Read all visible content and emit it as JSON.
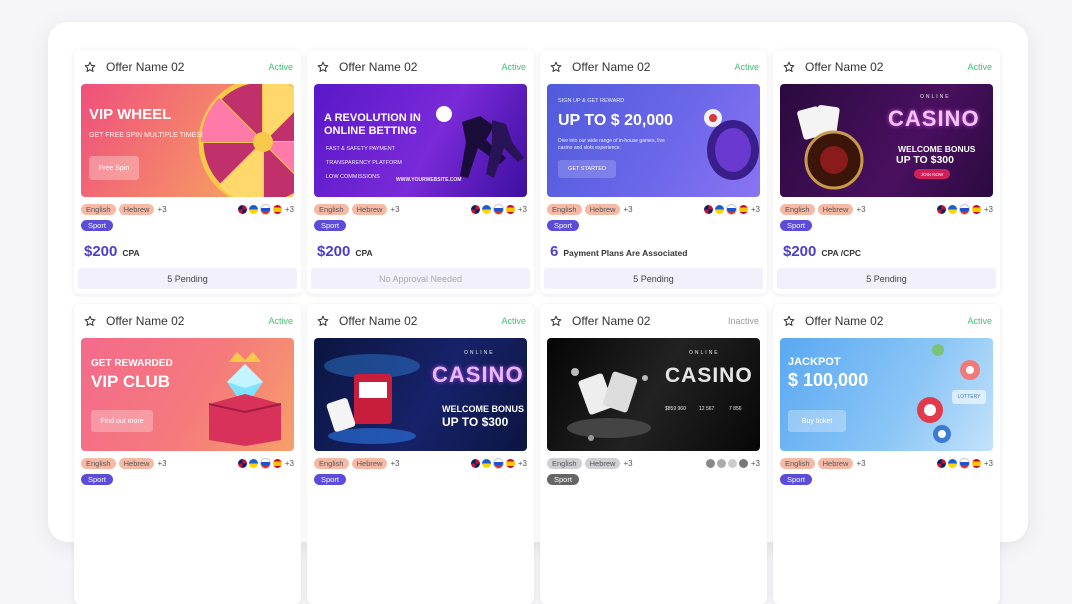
{
  "offers": [
    {
      "name": "Offer Name 02",
      "status": "Active",
      "tags": [
        "English",
        "Hebrew"
      ],
      "tags_more": "+3",
      "flags_more": "+3",
      "category": "Sport",
      "amount": "$200",
      "unit": "CPA",
      "footer": "5 Pending",
      "banner": {
        "title": "VIP WHEEL",
        "sub": "GET FREE SPIN MULTIPLE TIMES!",
        "button": "Free Spin"
      }
    },
    {
      "name": "Offer Name 02",
      "status": "Active",
      "tags": [
        "English",
        "Hebrew"
      ],
      "tags_more": "+3",
      "flags_more": "+3",
      "category": "Sport",
      "amount": "$200",
      "unit": "CPA",
      "footer": "No Approval Needed",
      "banner": {
        "title": "A REVOLUTION IN ONLINE BETTING",
        "bullets": [
          "FAST & SAFETY PAYMENT",
          "TRANSPARENCY PLATFORM",
          "LOW COMMISSIONS"
        ],
        "site": "WWW.YOURWEBSITE.COM"
      }
    },
    {
      "name": "Offer Name 02",
      "status": "Active",
      "tags": [
        "English",
        "Hebrew"
      ],
      "tags_more": "+3",
      "flags_more": "+3",
      "category": "Sport",
      "amount": "6",
      "unit": "Payment Plans Are Associated",
      "footer": "5 Pending",
      "banner": {
        "kicker": "SIGN UP & GET REWARD",
        "title": "UP TO $ 20,000",
        "sub": "Dive into our wide range of in-house games, live casino and slots experience",
        "button": "GET STARTED"
      }
    },
    {
      "name": "Offer Name 02",
      "status": "Active",
      "tags": [
        "English",
        "Hebrew"
      ],
      "tags_more": "+3",
      "flags_more": "+3",
      "category": "Sport",
      "amount": "$200",
      "unit": "CPA /CPC",
      "footer": "5 Pending",
      "banner": {
        "kicker": "ONLINE",
        "title": "CASINO",
        "sub": "WELCOME BONUS",
        "big": "UP TO $300",
        "button": "JOIN NOW"
      }
    },
    {
      "name": "Offer Name 02",
      "status": "Active",
      "tags": [
        "English",
        "Hebrew"
      ],
      "tags_more": "+3",
      "flags_more": "+3",
      "category": "Sport",
      "banner": {
        "title": "GET REWARDED",
        "title2": "VIP CLUB",
        "button": "Find out more"
      }
    },
    {
      "name": "Offer Name 02",
      "status": "Active",
      "tags": [
        "English",
        "Hebrew"
      ],
      "tags_more": "+3",
      "flags_more": "+3",
      "category": "Sport",
      "banner": {
        "kicker": "ONLINE",
        "title": "CASINO",
        "sub": "WELCOME BONUS",
        "big": "UP TO $300"
      }
    },
    {
      "name": "Offer Name 02",
      "status": "Inactive",
      "tags": [
        "English",
        "Hebrew"
      ],
      "tags_more": "+3",
      "flags_more": "+3",
      "category": "Sport",
      "banner": {
        "kicker": "ONLINE",
        "title": "CASINO",
        "stats": [
          "$859 960",
          "12 567",
          "7 856"
        ]
      }
    },
    {
      "name": "Offer Name 02",
      "status": "Active",
      "tags": [
        "English",
        "Hebrew"
      ],
      "tags_more": "+3",
      "flags_more": "+3",
      "category": "Sport",
      "banner": {
        "title": "JACKPOT",
        "title2": "$ 100,000",
        "button": "Buy ticket",
        "badge": "LOTTERY"
      }
    }
  ],
  "colors": {
    "accent": "#4a3fc9",
    "active": "#3ec46d",
    "lang_tag": "#f5b9a6",
    "category": "#5b4cd9"
  },
  "icons": {
    "favorite": "star-outline-icon",
    "flags": [
      "uk-flag-icon",
      "ukraine-flag-icon",
      "russia-flag-icon",
      "spain-flag-icon"
    ]
  }
}
